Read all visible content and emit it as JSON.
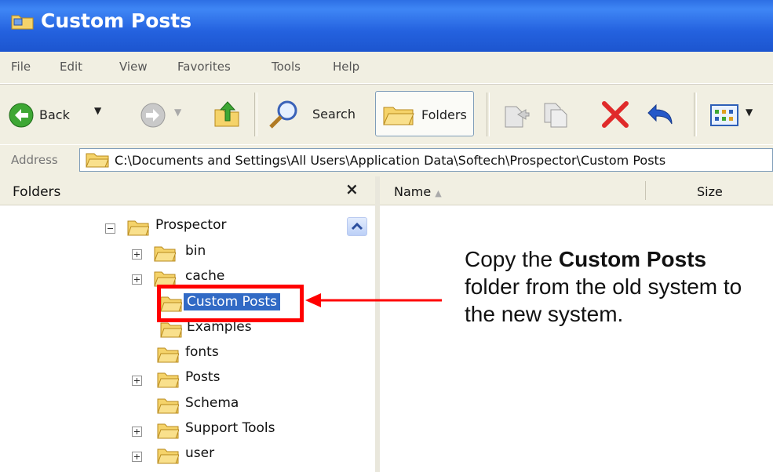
{
  "window": {
    "title": "Custom Posts"
  },
  "menu": [
    "File",
    "Edit",
    "View",
    "Favorites",
    "Tools",
    "Help"
  ],
  "toolbar": {
    "back_label": "Back",
    "search_label": "Search",
    "folders_label": "Folders"
  },
  "address": {
    "label": "Address",
    "path": "C:\\Documents and Settings\\All Users\\Application Data\\Softech\\Prospector\\Custom Posts"
  },
  "folders_pane": {
    "title": "Folders",
    "close": "×",
    "tree": [
      {
        "label": "Prospector",
        "expander": "minus"
      },
      {
        "label": "bin",
        "expander": "plus"
      },
      {
        "label": "cache",
        "expander": "plus"
      },
      {
        "label": "Custom Posts",
        "expander": "none",
        "selected": true
      },
      {
        "label": "Examples",
        "expander": "none"
      },
      {
        "label": "fonts",
        "expander": "none"
      },
      {
        "label": "Posts",
        "expander": "plus"
      },
      {
        "label": "Schema",
        "expander": "none"
      },
      {
        "label": "Support Tools",
        "expander": "plus"
      },
      {
        "label": "user",
        "expander": "plus"
      }
    ]
  },
  "list_pane": {
    "columns": [
      "Name",
      "Size"
    ]
  },
  "annotation": {
    "part1": "Copy the ",
    "bold": "Custom Posts",
    "part2": " folder from the old system to the new system.",
    "highlight_color": "#ff0000"
  },
  "colors": {
    "titlebar": "#2462df",
    "chrome": "#f1efe2",
    "selection": "#316ac5",
    "folder": "#f5d36a"
  },
  "icons": [
    "window-folder-icon",
    "back-arrow-icon",
    "forward-arrow-icon",
    "up-folder-icon",
    "search-magnifier-icon",
    "folders-icon",
    "move-to-icon",
    "copy-to-icon",
    "delete-x-icon",
    "undo-icon",
    "views-icon",
    "address-folder-icon",
    "folder-icon"
  ]
}
